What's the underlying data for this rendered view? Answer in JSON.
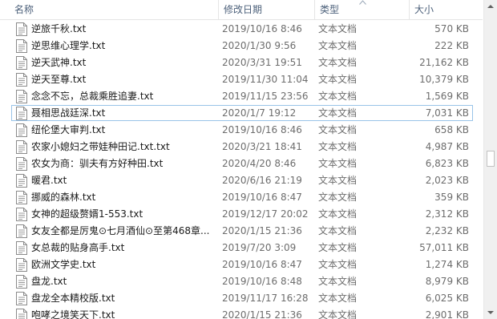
{
  "columns": {
    "name": "名称",
    "date": "修改日期",
    "type": "类型",
    "size": "大小"
  },
  "sort": {
    "column": "type",
    "direction": "ascending"
  },
  "colors": {
    "header_text": "#4c607a",
    "selection_border": "#99c4e8",
    "muted_text": "#6d6d6d"
  },
  "files": [
    {
      "name": "逆旅千秋.txt",
      "date": "2019/10/16 8:46",
      "type": "文本文档",
      "size": "570 KB",
      "selected": false
    },
    {
      "name": "逆思维心理学.txt",
      "date": "2020/1/30 9:56",
      "type": "文本文档",
      "size": "222 KB",
      "selected": false
    },
    {
      "name": "逆天武神.txt",
      "date": "2020/3/31 19:51",
      "type": "文本文档",
      "size": "21,162 KB",
      "selected": false
    },
    {
      "name": "逆天至尊.txt",
      "date": "2019/11/30 11:04",
      "type": "文本文档",
      "size": "10,379 KB",
      "selected": false
    },
    {
      "name": "念念不忘，总裁乘胜追妻.txt",
      "date": "2019/11/15 23:56",
      "type": "文本文档",
      "size": "1,569 KB",
      "selected": false
    },
    {
      "name": "聂相思战廷深.txt",
      "date": "2020/1/7 19:12",
      "type": "文本文档",
      "size": "7,031 KB",
      "selected": true
    },
    {
      "name": "纽伦堡大审判.txt",
      "date": "2019/10/16 8:46",
      "type": "文本文档",
      "size": "658 KB",
      "selected": false
    },
    {
      "name": "农家小媳妇之带娃种田记.txt.txt",
      "date": "2020/3/21 18:41",
      "type": "文本文档",
      "size": "4,987 KB",
      "selected": false
    },
    {
      "name": "农女为商：驯夫有方好种田.txt",
      "date": "2020/4/20 8:46",
      "type": "文本文档",
      "size": "6,823 KB",
      "selected": false
    },
    {
      "name": "暖君.txt",
      "date": "2020/6/16 21:19",
      "type": "文本文档",
      "size": "2,023 KB",
      "selected": false
    },
    {
      "name": "挪威的森林.txt",
      "date": "2019/10/16 8:47",
      "type": "文本文档",
      "size": "359 KB",
      "selected": false
    },
    {
      "name": "女神的超级赘婿1-553.txt",
      "date": "2019/12/17 20:02",
      "type": "文本文档",
      "size": "2,312 KB",
      "selected": false
    },
    {
      "name": "女友全都是厉鬼⊙七月酒仙⊙至第468章...",
      "date": "2020/1/15 21:36",
      "type": "文本文档",
      "size": "2,232 KB",
      "selected": false
    },
    {
      "name": "女总裁的贴身高手.txt",
      "date": "2019/7/20 3:09",
      "type": "文本文档",
      "size": "57,011 KB",
      "selected": false
    },
    {
      "name": "欧洲文学史.txt",
      "date": "2019/10/16 8:47",
      "type": "文本文档",
      "size": "1,274 KB",
      "selected": false
    },
    {
      "name": "盘龙.txt",
      "date": "2019/10/16 8:48",
      "type": "文本文档",
      "size": "8,979 KB",
      "selected": false
    },
    {
      "name": "盘龙全本精校版.txt",
      "date": "2019/11/17 16:28",
      "type": "文本文档",
      "size": "6,025 KB",
      "selected": false
    },
    {
      "name": "咆哮之境笑天下.txt",
      "date": "2020/1/15 21:36",
      "type": "文本文档",
      "size": "2,901 KB",
      "selected": false
    }
  ]
}
